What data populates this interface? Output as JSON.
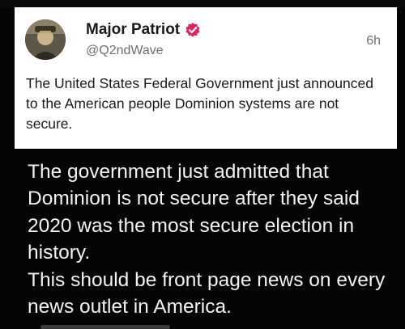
{
  "tweet": {
    "display_name": "Major Patriot",
    "handle": "@Q2ndWave",
    "timestamp": "6h",
    "text": "The United States Federal Government just announced to the American people Dominion systems are not secure.",
    "verified_icon": "verified-badge-icon",
    "verified_color": "#e0245e"
  },
  "caption": {
    "text": "The government just admitted that Dominion is not secure after they said 2020 was the most secure election in history.\nThis should be front page news on every news outlet in America."
  }
}
